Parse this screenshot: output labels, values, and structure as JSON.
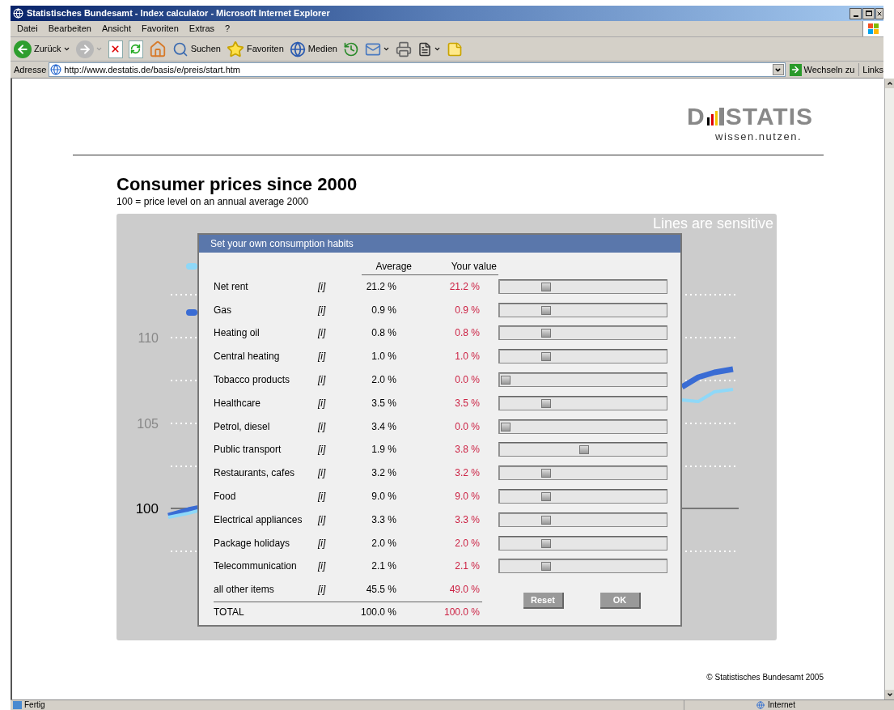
{
  "window": {
    "title": "Statistisches Bundesamt - Index calculator - Microsoft Internet Explorer"
  },
  "menu": [
    "Datei",
    "Bearbeiten",
    "Ansicht",
    "Favoriten",
    "Extras",
    "?"
  ],
  "toolbar": [
    {
      "kind": "back",
      "label": "Zurück"
    },
    {
      "kind": "forward"
    },
    {
      "kind": "stop"
    },
    {
      "kind": "refresh"
    },
    {
      "kind": "home"
    },
    {
      "kind": "search",
      "label": "Suchen"
    },
    {
      "kind": "favorites",
      "label": "Favoriten"
    },
    {
      "kind": "media",
      "label": "Medien"
    },
    {
      "kind": "history"
    },
    {
      "kind": "mail"
    },
    {
      "kind": "print"
    },
    {
      "kind": "edit"
    },
    {
      "kind": "note"
    }
  ],
  "address_bar": {
    "label": "Adresse",
    "value": "http://www.destatis.de/basis/e/preis/start.htm",
    "go": "Wechseln zu",
    "links": "Links"
  },
  "logo": {
    "left": "D",
    "right": "STATIS",
    "tagline": "wissen.nutzen."
  },
  "title": "Consumer prices since 2000",
  "subtitle": "100 = price level on an annual average 2000",
  "chart": {
    "note": "Lines are sensitive",
    "y_labels": [
      "110",
      "105",
      "100"
    ],
    "lines": [
      {
        "color": "#8ed8f8"
      },
      {
        "color": "#3a6cd4"
      }
    ]
  },
  "dialog": {
    "title": "Set your own consumption habits",
    "columns": [
      "Average",
      "Your value"
    ],
    "rows": [
      {
        "name": "Net rent",
        "info": "[i]",
        "average": "21.2 %",
        "value": "21.2 %",
        "level": 0.26
      },
      {
        "name": "Gas",
        "info": "[i]",
        "average": "0.9 %",
        "value": "0.9 %",
        "level": 0.26
      },
      {
        "name": "Heating oil",
        "info": "[i]",
        "average": "0.8 %",
        "value": "0.8 %",
        "level": 0.26
      },
      {
        "name": "Central heating",
        "info": "[i]",
        "average": "1.0 %",
        "value": "1.0 %",
        "level": 0.26
      },
      {
        "name": "Tobacco products",
        "info": "[i]",
        "average": "2.0 %",
        "value": "0.0 %",
        "level": 0
      },
      {
        "name": "Healthcare",
        "info": "[i]",
        "average": "3.5 %",
        "value": "3.5 %",
        "level": 0.26
      },
      {
        "name": "Petrol, diesel",
        "info": "[i]",
        "average": "3.4 %",
        "value": "0.0 %",
        "level": 0
      },
      {
        "name": "Public transport",
        "info": "[i]",
        "average": "1.9 %",
        "value": "3.8 %",
        "level": 0.5
      },
      {
        "name": "Restaurants, cafes",
        "info": "[i]",
        "average": "3.2 %",
        "value": "3.2 %",
        "level": 0.26
      },
      {
        "name": "Food",
        "info": "[i]",
        "average": "9.0 %",
        "value": "9.0 %",
        "level": 0.26
      },
      {
        "name": "Electrical appliances",
        "info": "[i]",
        "average": "3.3 %",
        "value": "3.3 %",
        "level": 0.26
      },
      {
        "name": "Package holidays",
        "info": "[i]",
        "average": "2.0 %",
        "value": "2.0 %",
        "level": 0.26
      },
      {
        "name": "Telecommunication",
        "info": "[i]",
        "average": "2.1 %",
        "value": "2.1 %",
        "level": 0.26
      },
      {
        "name": "all other items",
        "info": "[i]",
        "average": "45.5 %",
        "value": "49.0 %"
      }
    ],
    "total": {
      "name": "TOTAL",
      "average": "100.0 %",
      "value": "100.0 %"
    },
    "buttons": [
      "Reset",
      "OK"
    ]
  },
  "copyright": "© Statistisches Bundesamt 2005",
  "status_bar": {
    "text": "Fertig",
    "zone": "Internet"
  }
}
